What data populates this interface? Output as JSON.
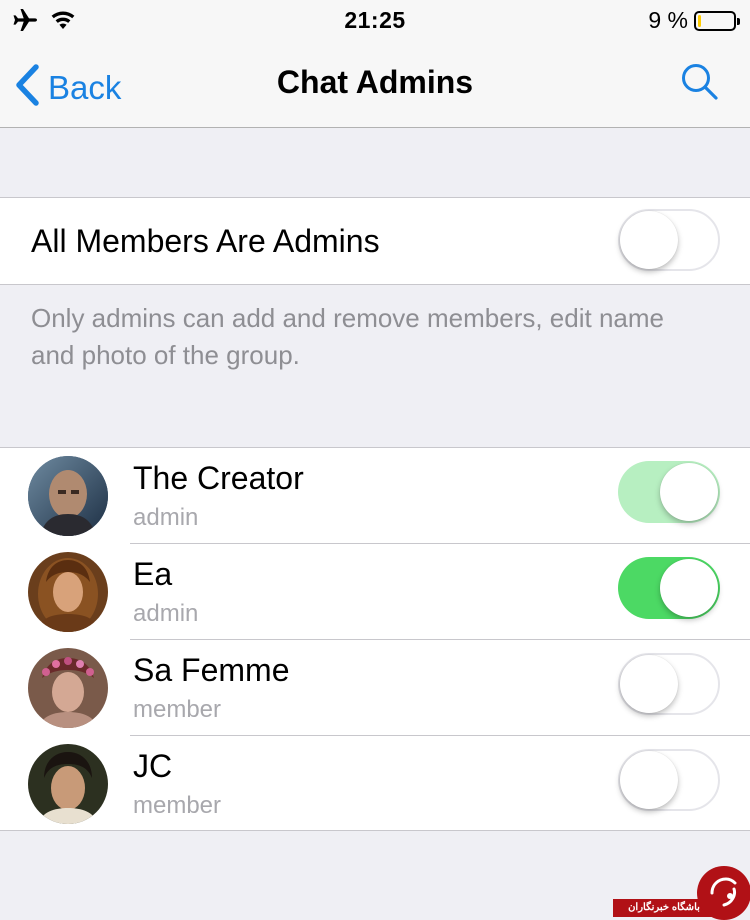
{
  "status_bar": {
    "time": "21:25",
    "battery_text": "9 %",
    "battery_level": 0.09,
    "battery_color": "#ffcc00",
    "icons": [
      "airplane-icon",
      "wifi-icon",
      "battery-icon"
    ]
  },
  "nav": {
    "back_label": "Back",
    "title": "Chat Admins",
    "accent": "#1a82e2"
  },
  "all_members": {
    "label": "All Members Are Admins",
    "enabled": false
  },
  "footnote": "Only admins can add and remove members, edit name and photo of the group.",
  "members": [
    {
      "name": "The Creator",
      "role": "admin",
      "admin": true,
      "locked": true
    },
    {
      "name": "Ea",
      "role": "admin",
      "admin": true,
      "locked": false
    },
    {
      "name": "Sa Femme",
      "role": "member",
      "admin": false,
      "locked": false
    },
    {
      "name": "JC",
      "role": "member",
      "admin": false,
      "locked": false
    }
  ],
  "watermark": {
    "text": "باشگاه خبرنگاران"
  }
}
